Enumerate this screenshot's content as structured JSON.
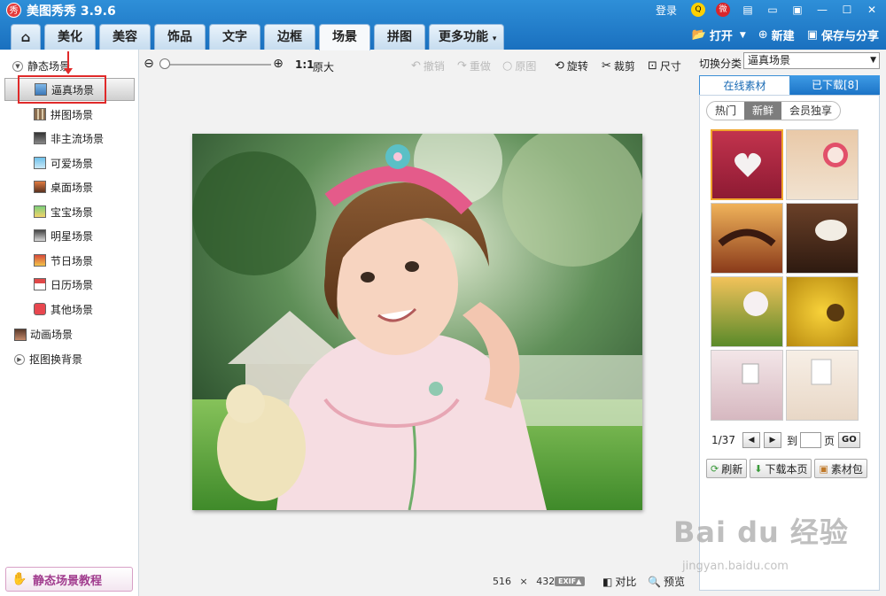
{
  "app": {
    "logo_char": "秀",
    "title": "美图秀秀 3.9.6"
  },
  "window": {
    "login": "登录"
  },
  "tabs": [
    {
      "label": "⌂",
      "icon": "home-icon"
    },
    {
      "label": "美化"
    },
    {
      "label": "美容"
    },
    {
      "label": "饰品"
    },
    {
      "label": "文字"
    },
    {
      "label": "边框"
    },
    {
      "label": "场景",
      "active": true
    },
    {
      "label": "拼图"
    },
    {
      "label": "更多功能"
    }
  ],
  "top_actions": {
    "open": "打开",
    "new": "新建",
    "save_share": "保存与分享"
  },
  "left": {
    "group_static": "静态场景",
    "items": [
      {
        "label": "逼真场景",
        "selected": true
      },
      {
        "label": "拼图场景"
      },
      {
        "label": "非主流场景"
      },
      {
        "label": "可爱场景"
      },
      {
        "label": "桌面场景"
      },
      {
        "label": "宝宝场景"
      },
      {
        "label": "明星场景"
      },
      {
        "label": "节日场景"
      },
      {
        "label": "日历场景"
      },
      {
        "label": "其他场景"
      }
    ],
    "group_anim": "动画场景",
    "group_matting": "抠图换背景",
    "tutorial": "静态场景教程"
  },
  "toolbar": {
    "ratio": "1:1",
    "original_size": "原大",
    "undo": "撤销",
    "redo": "重做",
    "original": "原图",
    "rotate": "旋转",
    "crop": "裁剪",
    "resize": "尺寸"
  },
  "canvas": {
    "width": "516",
    "x": "×",
    "height": "432"
  },
  "bottom": {
    "exif": "EXIF▲",
    "compare": "对比",
    "preview": "预览"
  },
  "right": {
    "category_label": "切换分类",
    "category_value": "逼真场景",
    "tab_online": "在线素材",
    "tab_downloaded": "已下载[8]",
    "filters": [
      "热门",
      "新鲜",
      "会员独享"
    ],
    "active_filter": "新鲜",
    "page": "1/37",
    "goto": "到",
    "page_unit": "页",
    "go": "GO",
    "refresh": "刷新",
    "download_page": "下载本页",
    "package": "素材包"
  },
  "watermark": {
    "brand": "Bai du 经验",
    "url": "jingyan.baidu.com"
  },
  "colors": {
    "title_bar": "#1f7bc9",
    "selection_red": "#e02a2a",
    "thumb_selected": "#f0a52c"
  }
}
